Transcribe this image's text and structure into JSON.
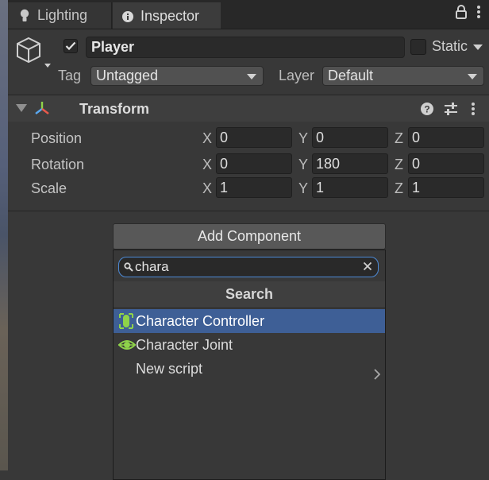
{
  "tabs": {
    "lighting": "Lighting",
    "inspector": "Inspector"
  },
  "object": {
    "active": true,
    "name": "Player",
    "static_label": "Static",
    "tag_label": "Tag",
    "tag_value": "Untagged",
    "layer_label": "Layer",
    "layer_value": "Default"
  },
  "transform": {
    "title": "Transform",
    "rows": [
      {
        "label": "Position",
        "x": "0",
        "y": "0",
        "z": "0"
      },
      {
        "label": "Rotation",
        "x": "0",
        "y": "180",
        "z": "0"
      },
      {
        "label": "Scale",
        "x": "1",
        "y": "1",
        "z": "1"
      }
    ],
    "axis_labels": {
      "x": "X",
      "y": "Y",
      "z": "Z"
    }
  },
  "add_component": {
    "button_label": "Add Component",
    "search_value": "chara",
    "popup_title": "Search",
    "items": [
      {
        "label": "Character Controller",
        "icon": "character-controller-icon",
        "selected": true
      },
      {
        "label": "Character Joint",
        "icon": "character-joint-icon",
        "selected": false
      },
      {
        "label": "New script",
        "icon": "chevron-right-icon",
        "selected": false
      }
    ]
  },
  "colors": {
    "accent_selection": "#3e5f96",
    "search_focus": "#4d8ad6",
    "component_icon_green": "#8fd34a"
  }
}
